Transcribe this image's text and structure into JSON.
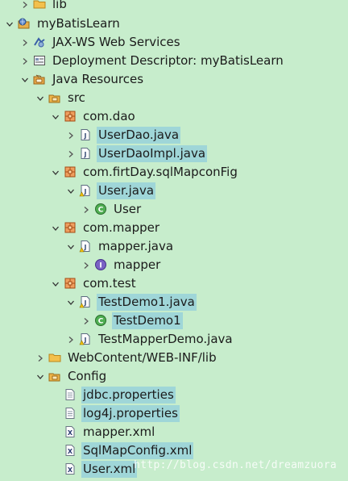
{
  "tree": {
    "rows": [
      {
        "label": "lib",
        "icon": "folder-icon",
        "toggle": "collapsed",
        "selected": false
      },
      {
        "label": "myBatisLearn",
        "icon": "web-project-icon",
        "toggle": "expanded",
        "selected": false
      },
      {
        "label": "JAX-WS Web Services",
        "icon": "web-services-icon",
        "toggle": "collapsed",
        "selected": false
      },
      {
        "label": "Deployment Descriptor: myBatisLearn",
        "icon": "deployment-descriptor-icon",
        "toggle": "collapsed",
        "selected": false
      },
      {
        "label": "Java Resources",
        "icon": "java-resources-icon",
        "toggle": "expanded",
        "selected": false
      },
      {
        "label": "src",
        "icon": "source-folder-icon",
        "toggle": "expanded",
        "selected": false
      },
      {
        "label": "com.dao",
        "icon": "package-icon",
        "toggle": "expanded",
        "selected": false
      },
      {
        "label": "UserDao.java",
        "icon": "java-file-icon",
        "toggle": "collapsed",
        "selected": true
      },
      {
        "label": "UserDaoImpl.java",
        "icon": "java-file-icon",
        "toggle": "collapsed",
        "selected": true
      },
      {
        "label": "com.firtDay.sqlMapconFig",
        "icon": "package-icon",
        "toggle": "expanded",
        "selected": false
      },
      {
        "label": "User.java",
        "icon": "java-file-warning-icon",
        "toggle": "expanded",
        "selected": true
      },
      {
        "label": "User",
        "icon": "class-icon",
        "toggle": "collapsed",
        "selected": false
      },
      {
        "label": "com.mapper",
        "icon": "package-icon",
        "toggle": "expanded",
        "selected": false
      },
      {
        "label": "mapper.java",
        "icon": "java-file-warning-icon",
        "toggle": "expanded",
        "selected": false
      },
      {
        "label": "mapper",
        "icon": "interface-icon",
        "toggle": "collapsed",
        "selected": false
      },
      {
        "label": "com.test",
        "icon": "package-icon",
        "toggle": "expanded",
        "selected": false
      },
      {
        "label": "TestDemo1.java",
        "icon": "java-file-warning-icon",
        "toggle": "expanded",
        "selected": true
      },
      {
        "label": "TestDemo1",
        "icon": "class-icon",
        "toggle": "collapsed",
        "selected": true
      },
      {
        "label": "TestMapperDemo.java",
        "icon": "java-file-warning-icon",
        "toggle": "collapsed",
        "selected": false
      },
      {
        "label": "WebContent/WEB-INF/lib",
        "icon": "folder-icon",
        "toggle": "collapsed",
        "selected": false
      },
      {
        "label": "Config",
        "icon": "source-folder-icon",
        "toggle": "expanded",
        "selected": false
      },
      {
        "label": "jdbc.properties",
        "icon": "properties-file-icon",
        "toggle": "none",
        "selected": true
      },
      {
        "label": "log4j.properties",
        "icon": "properties-file-icon",
        "toggle": "none",
        "selected": true
      },
      {
        "label": "mapper.xml",
        "icon": "xml-file-icon",
        "toggle": "none",
        "selected": false
      },
      {
        "label": "SqlMapConfig.xml",
        "icon": "xml-file-icon",
        "toggle": "none",
        "selected": true
      },
      {
        "label": "User.xml",
        "icon": "xml-file-icon",
        "toggle": "none",
        "selected": true
      }
    ]
  },
  "watermark": "http://blog.csdn.net/dreamzuora",
  "colors": {
    "background": "#c7edcc",
    "selection": "#9fd6d8"
  }
}
